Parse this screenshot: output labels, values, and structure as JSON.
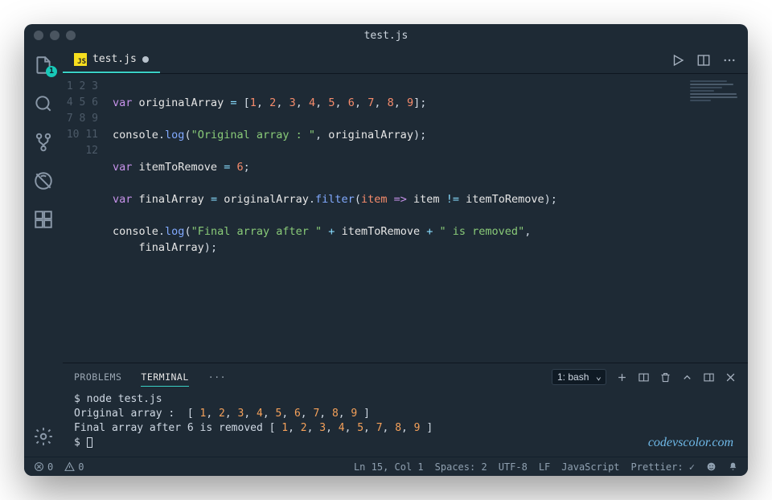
{
  "window": {
    "title": "test.js"
  },
  "tab": {
    "filename": "test.js",
    "lang_badge": "JS"
  },
  "code": {
    "lines": [
      "1",
      "2",
      "3",
      "4",
      "5",
      "6",
      "7",
      "8",
      "9",
      "10",
      "11",
      "12"
    ],
    "l2": {
      "kw": "var",
      "id": "originalArray",
      "eq": "=",
      "br_o": "[",
      "n1": "1",
      "n2": "2",
      "n3": "3",
      "n4": "4",
      "n5": "5",
      "n6": "6",
      "n7": "7",
      "n8": "8",
      "n9": "9",
      "br_c": "]",
      "semi": ";"
    },
    "l4": {
      "obj": "console",
      "dot": ".",
      "fn": "log",
      "po": "(",
      "str": "\"Original array : \"",
      "comma": ", ",
      "arg": "originalArray",
      "pc": ")",
      "semi": ";"
    },
    "l6": {
      "kw": "var",
      "id": "itemToRemove",
      "eq": "=",
      "num": "6",
      "semi": ";"
    },
    "l8": {
      "kw": "var",
      "id": "finalArray",
      "eq": "=",
      "src": "originalArray",
      "dot": ".",
      "fn": "filter",
      "po": "(",
      "param": "item",
      "arrow": "=>",
      "left": "item",
      "neq": "!=",
      "right": "itemToRemove",
      "pc": ")",
      "semi": ";"
    },
    "l10": {
      "obj": "console",
      "dot": ".",
      "fn": "log",
      "po": "(",
      "s1": "\"Final array after \"",
      "plus1": "+",
      "v": "itemToRemove",
      "plus2": "+",
      "s2": "\" is removed\"",
      "comma": ","
    },
    "l10b": {
      "indent": "    ",
      "arg": "finalArray",
      "pc": ")",
      "semi": ";"
    }
  },
  "panel": {
    "tabs": {
      "problems": "PROBLEMS",
      "terminal": "TERMINAL",
      "more": "···"
    },
    "terminal_select": "1: bash"
  },
  "terminal": {
    "l1": "$ node test.js",
    "l2_pre": "Original array :  [ ",
    "l2_nums": [
      "1",
      "2",
      "3",
      "4",
      "5",
      "6",
      "7",
      "8",
      "9"
    ],
    "l2_post": " ]",
    "l3_pre": "Final array after 6 is removed [ ",
    "l3_nums": [
      "1",
      "2",
      "3",
      "4",
      "5",
      "7",
      "8",
      "9"
    ],
    "l3_post": " ]",
    "l4": "$ "
  },
  "status": {
    "errors": "0",
    "warnings": "0",
    "cursor": "Ln 15, Col 1",
    "spaces": "Spaces: 2",
    "encoding": "UTF-8",
    "eol": "LF",
    "lang": "JavaScript",
    "prettier": "Prettier: ✓"
  },
  "activity_badge": "1",
  "watermark": "codevscolor.com"
}
